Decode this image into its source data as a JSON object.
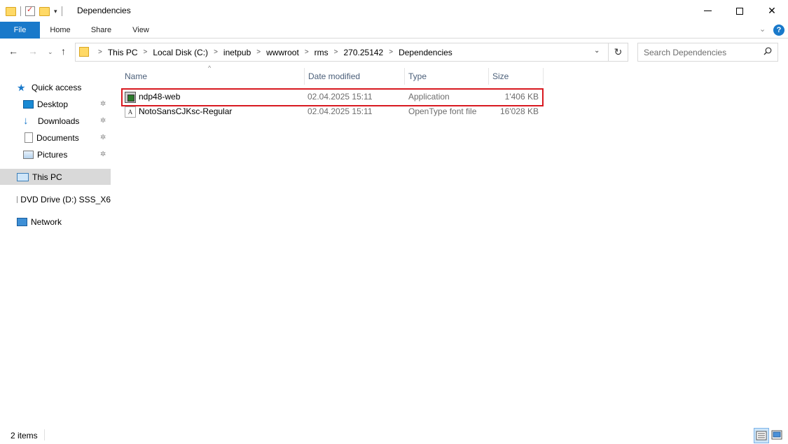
{
  "window": {
    "title": "Dependencies",
    "qat_dropdown": "▾",
    "minimize_label": "",
    "maximize_label": "",
    "close_label": "✕"
  },
  "ribbon": {
    "tabs": [
      "File",
      "Home",
      "Share",
      "View"
    ],
    "expand": "⌄",
    "help": "?"
  },
  "address": {
    "breadcrumbs": [
      "This PC",
      "Local Disk (C:)",
      "inetpub",
      "wwwroot",
      "rms",
      "270.25142",
      "Dependencies"
    ],
    "separator": ">",
    "dropdown": "⌄",
    "refresh": "↻"
  },
  "nav_buttons": {
    "back": "←",
    "forward": "→",
    "recent": "⌄",
    "up": "↑"
  },
  "search": {
    "placeholder": "Search Dependencies",
    "value": ""
  },
  "navpane": {
    "items": [
      {
        "label": "Quick access",
        "icon": "star-icon",
        "pinned": false
      },
      {
        "label": "Desktop",
        "icon": "desktop-icon",
        "pinned": true
      },
      {
        "label": "Downloads",
        "icon": "download-arrow-icon",
        "pinned": true
      },
      {
        "label": "Documents",
        "icon": "document-icon",
        "pinned": true
      },
      {
        "label": "Pictures",
        "icon": "pictures-icon",
        "pinned": true
      },
      {
        "label": "This PC",
        "icon": "computer-icon",
        "pinned": false,
        "selected": true
      },
      {
        "label": "DVD Drive (D:) SSS_X6",
        "icon": "dvd-drive-icon",
        "pinned": false
      },
      {
        "label": "Network",
        "icon": "network-icon",
        "pinned": false
      }
    ],
    "pin_glyph": "📌"
  },
  "filelist": {
    "columns": {
      "name": "Name",
      "date": "Date modified",
      "type": "Type",
      "size": "Size"
    },
    "sort_indicator": "^",
    "rows": [
      {
        "name": "ndp48-web",
        "date": "02.04.2025 15:11",
        "type": "Application",
        "size": "1'406 KB",
        "icon": "application-icon",
        "highlighted": true
      },
      {
        "name": "NotoSansCJKsc-Regular",
        "date": "02.04.2025 15:11",
        "type": "OpenType font file",
        "size": "16'028 KB",
        "icon": "font-file-icon",
        "highlighted": false
      }
    ]
  },
  "status": {
    "item_count": "2 items"
  },
  "colors": {
    "accent": "#1979ca",
    "highlight_border": "#d81920",
    "selected_nav": "#d9d9d9"
  }
}
